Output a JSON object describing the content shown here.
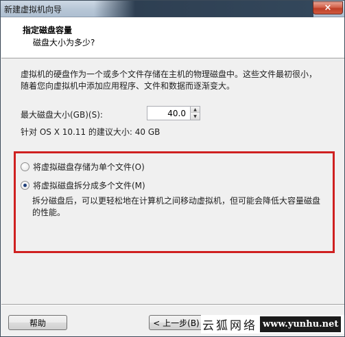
{
  "window": {
    "title": "新建虚拟机向导",
    "close_glyph": "×"
  },
  "header": {
    "title": "指定磁盘容量",
    "subtitle": "磁盘大小为多少?"
  },
  "description": "虚拟机的硬盘作为一个或多个文件存储在主机的物理磁盘中。这些文件最初很小，随着您向虚拟机中添加应用程序、文件和数据而逐渐变大。",
  "max_disk": {
    "label": "最大磁盘大小(GB)(S):",
    "value": "40.0",
    "up_glyph": "▲",
    "down_glyph": "▼"
  },
  "recommended": "针对 OS X 10.11 的建议大小: 40 GB",
  "options": {
    "single_file": {
      "label": "将虚拟磁盘存储为单个文件(O)",
      "checked": false
    },
    "split_files": {
      "label": "将虚拟磁盘拆分成多个文件(M)",
      "checked": true
    },
    "split_description": "拆分磁盘后，可以更轻松地在计算机之间移动虚拟机，但可能会降低大容量磁盘的性能。"
  },
  "buttons": {
    "help": "帮助",
    "back": "< 上一步(B)"
  },
  "watermark": {
    "cn": "云狐网络",
    "url": "www.yunhu.net"
  },
  "colors": {
    "highlight_border": "#cf2020",
    "dialog_bg": "#f0f0f0"
  }
}
